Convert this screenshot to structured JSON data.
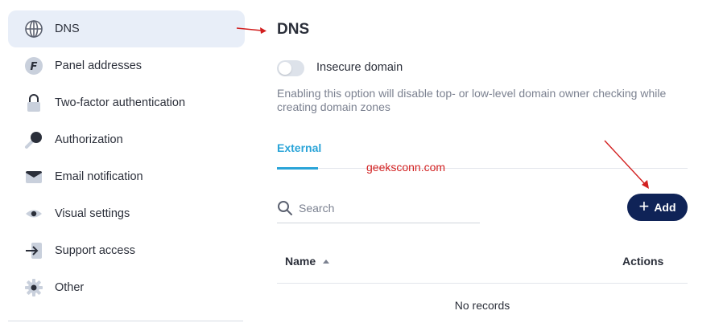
{
  "sidebar": {
    "items": [
      {
        "label": "DNS",
        "icon": "globe-icon",
        "active": true
      },
      {
        "label": "Panel addresses",
        "icon": "panel-f-icon"
      },
      {
        "label": "Two-factor authentication",
        "icon": "lock-icon"
      },
      {
        "label": "Authorization",
        "icon": "key-icon"
      },
      {
        "label": "Email notification",
        "icon": "envelope-icon"
      },
      {
        "label": "Visual settings",
        "icon": "eye-icon"
      },
      {
        "label": "Support access",
        "icon": "arrow-right-icon"
      },
      {
        "label": "Other",
        "icon": "gear-icon"
      }
    ]
  },
  "main": {
    "title": "DNS",
    "toggle": {
      "label": "Insecure domain",
      "checked": false,
      "description": "Enabling this option will disable top- or low-level domain owner checking while creating domain zones"
    },
    "tabs": [
      {
        "label": "External",
        "active": true
      }
    ],
    "watermark": "geeksconn.com",
    "search": {
      "placeholder": "Search",
      "value": ""
    },
    "add_button": {
      "label": "Add"
    },
    "table": {
      "columns": [
        "Name",
        "Actions"
      ],
      "empty_text": "No records"
    }
  },
  "colors": {
    "accent": "#2aa4d8",
    "primary_button": "#0f2357",
    "active_nav": "#e8eef8",
    "annotation": "#d21f1f"
  }
}
